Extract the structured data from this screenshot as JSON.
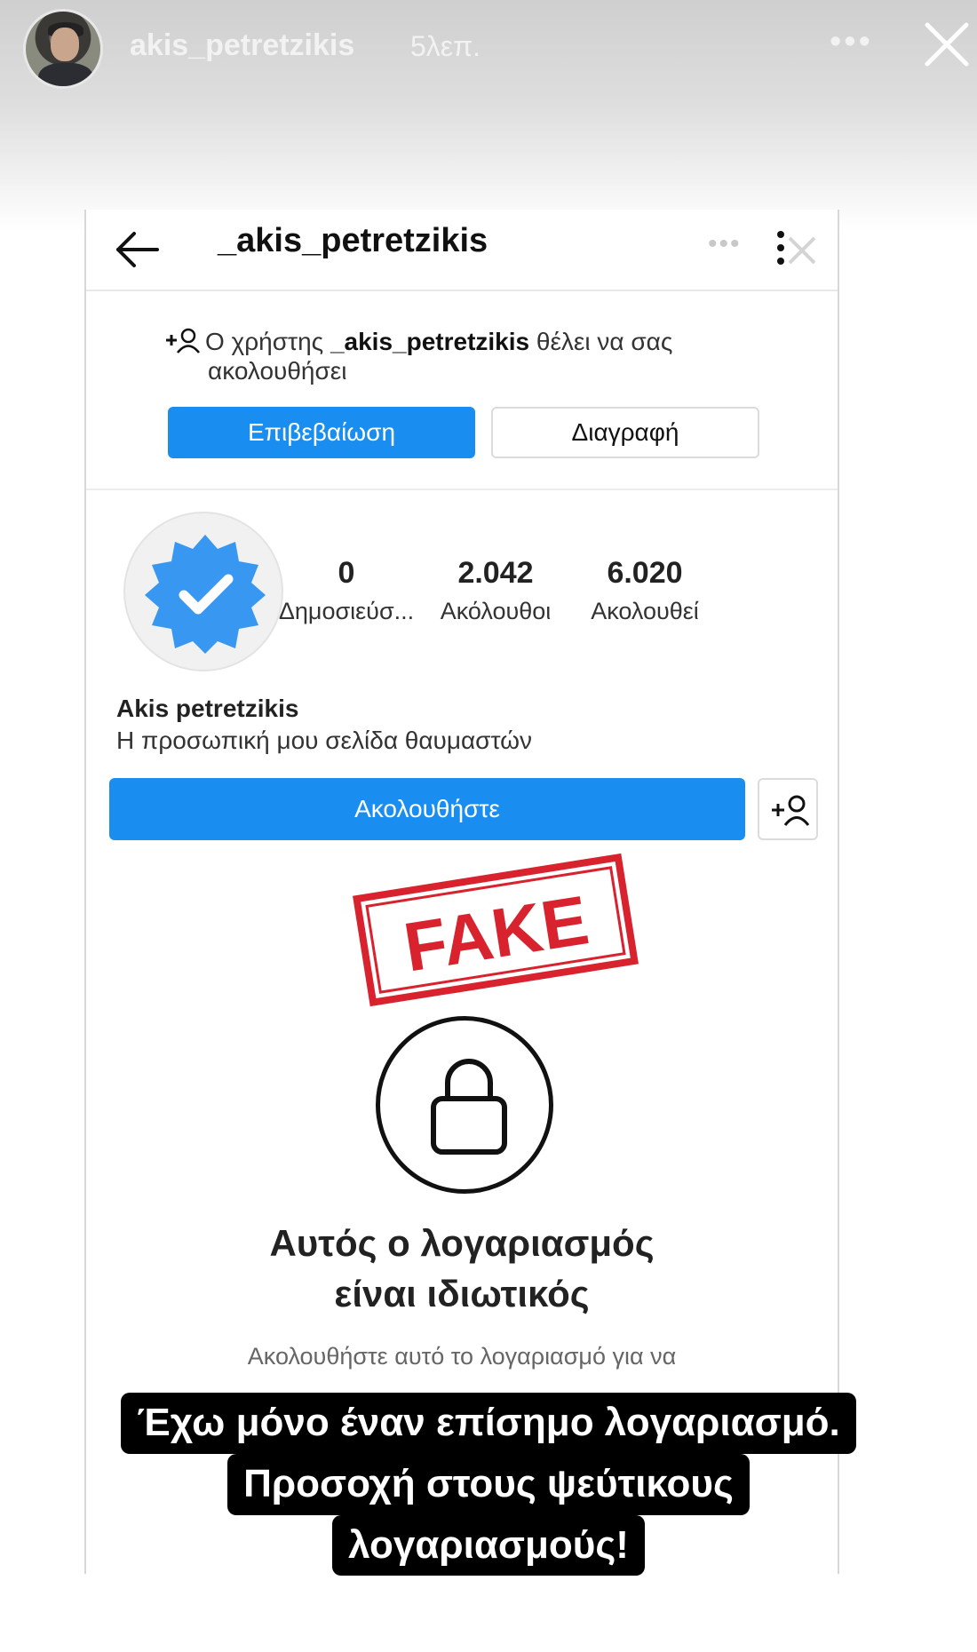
{
  "story": {
    "username": "akis_petretzikis",
    "time": "5λεπ.",
    "more": "•••"
  },
  "screen": {
    "handle": "_akis_petretzikis",
    "faded_more": "•••",
    "request": {
      "prefix": "Ο χρήστης ",
      "user": "_akis_petretzikis",
      "suffix": " θέλει να σας",
      "line2": "ακολουθήσει"
    },
    "confirm_label": "Επιβεβαίωση",
    "delete_label": "Διαγραφή",
    "stats": [
      {
        "value": "0",
        "label": "Δημοσιεύσ..."
      },
      {
        "value": "2.042",
        "label": "Ακόλουθοι"
      },
      {
        "value": "6.020",
        "label": "Ακολουθεί"
      }
    ],
    "name": "Akis petretzikis",
    "bio": "Η προσωπική μου σελίδα θαυμαστών",
    "follow_label": "Ακολουθήστε",
    "stamp": "FAKE",
    "private_title_1": "Αυτός ο λογαριασμός",
    "private_title_2": "είναι ιδιωτικός",
    "private_sub": "Ακολουθήστε αυτό το λογαριασμό για να"
  },
  "caption": {
    "line1": "Έχω μόνο έναν επίσημο λογαριασμό.",
    "line2": "Προσοχή στους ψεύτικους",
    "line3": "λογαριασμούς!"
  },
  "colors": {
    "accent": "#1a8ef0",
    "stamp": "#d8232f",
    "badge": "#3897f0"
  }
}
